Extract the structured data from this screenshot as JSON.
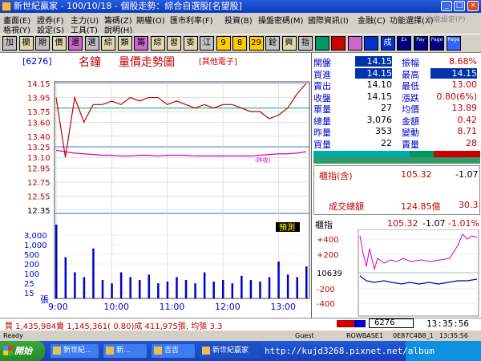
{
  "window": {
    "title": "新世紀贏家 - 100/10/18 - 個股走勢：綜合自選股[名望股]",
    "controls": [
      "_",
      "□",
      "×"
    ]
  },
  "menu": {
    "row1": [
      "畫面(E)",
      "證券(F)",
      "主力(U)",
      "籌碼(Z)",
      "期權(O)",
      "匯市利率(F)",
      "投資(B)",
      "操盤密碼(M)",
      "國際資訊(I)",
      "金融(C)",
      "功能選擇(X)",
      "功能設定(P)"
    ],
    "row2": [
      "格視(Y)",
      "設定(S)",
      "工具(T)",
      "說明(H)"
    ]
  },
  "toolbar": {
    "buttons": [
      "加",
      "欄",
      "期",
      "價",
      "還",
      "選",
      "綜",
      "類",
      "籌",
      "綜",
      "習",
      "委",
      "江",
      "9",
      "8",
      "29",
      "銓",
      "興",
      "指",
      "",
      "",
      "",
      "",
      "成",
      "Ex",
      "Pay",
      "Page",
      "Page"
    ]
  },
  "chart": {
    "stock_code": "[6276]",
    "name": "名鐘",
    "title": "量價走勢圖",
    "category": "[其他電子]",
    "ref_label": "(昨收)",
    "est_vol_label": "預測",
    "unit_label": "張",
    "price_ticks": [
      "14.15",
      "13.95",
      "13.75",
      "13.60",
      "13.40",
      "13.25",
      "13.10",
      "12.95",
      "12.75",
      "12.55",
      "12.35"
    ],
    "volume_ticks": [
      "3,000",
      "1,000",
      "500",
      "200",
      "100",
      "25",
      "15"
    ],
    "time_ticks": [
      "9:00",
      "10:00",
      "11:00",
      "12:00",
      "13:00"
    ],
    "colors": {
      "price": "#c00000",
      "avg": "#cc00cc",
      "volume": "#0000cc",
      "grid": "#00aa66"
    }
  },
  "chart_data": {
    "type": "line",
    "x": [
      "9:00",
      "9:10",
      "9:20",
      "9:30",
      "9:40",
      "9:50",
      "10:00",
      "10:10",
      "10:20",
      "10:30",
      "10:40",
      "10:50",
      "11:00",
      "11:10",
      "11:20",
      "11:30",
      "11:40",
      "11:50",
      "12:00",
      "12:10",
      "12:20",
      "12:30",
      "12:40",
      "12:50",
      "13:00",
      "13:10",
      "13:20",
      "13:30"
    ],
    "series": [
      {
        "values": [
          13.95,
          13.1,
          13.95,
          13.6,
          13.85,
          13.85,
          13.9,
          13.85,
          13.95,
          13.9,
          13.95,
          13.95,
          13.85,
          13.9,
          13.85,
          13.8,
          13.85,
          13.8,
          13.85,
          13.85,
          13.8,
          13.75,
          13.75,
          13.65,
          13.7,
          13.8,
          14.0,
          14.15
        ]
      },
      {
        "values": [
          13.2,
          13.18,
          13.16,
          13.15,
          13.14,
          13.13,
          13.13,
          13.12,
          13.12,
          13.13,
          13.13,
          13.12,
          13.13,
          13.13,
          13.13,
          13.12,
          13.12,
          13.12,
          13.12,
          13.12,
          13.12,
          13.12,
          13.13,
          13.14,
          13.15,
          13.15,
          13.16,
          13.18
        ]
      }
    ],
    "volume": [
      480,
      150,
      60,
      40,
      220,
      30,
      20,
      60,
      40,
      30,
      50,
      20,
      25,
      40,
      30,
      20,
      60,
      25,
      30,
      20,
      45,
      30,
      25,
      40,
      120,
      50,
      40,
      90
    ],
    "ylim": [
      12.35,
      14.15
    ],
    "reference_price": 13.25
  },
  "quote": {
    "rows": [
      {
        "l1": "開盤",
        "v1": "14.15",
        "l2": "振幅",
        "v2": "8.68%"
      },
      {
        "l1": "買進",
        "v1": "14.15",
        "l2": "最高",
        "v2": "14.15"
      },
      {
        "l1": "賣出",
        "v1": "14.10",
        "l2": "最低",
        "v2": "13.00"
      },
      {
        "l1": "收盤",
        "v1": "14.15",
        "l2": "漲跌",
        "v2": "0.80(6%)"
      },
      {
        "l1": "單量",
        "v1": "27",
        "l2": "均價",
        "v2": "13.89"
      },
      {
        "l1": "總量",
        "v1": "3,076",
        "l2": "金額",
        "v2": "0.42"
      },
      {
        "l1": "昨量",
        "v1": "353",
        "l2": "變動",
        "v2": "8.71"
      },
      {
        "l1": "買量",
        "v1": "22",
        "l2": "賣量",
        "v2": "28"
      }
    ]
  },
  "index_panel": {
    "label": "櫃指(含)",
    "value": "105.32",
    "change": "-1.07",
    "turnover_label": "成交總額",
    "turnover_value": "124.85億",
    "turnover_change": "30.3"
  },
  "mini_chart": {
    "label": "櫃指",
    "value": "105.32",
    "change": "-1.07",
    "pct": "-1.01%",
    "y_ticks": [
      "+400",
      "+200",
      "10639",
      "-200",
      "-400"
    ]
  },
  "status": {
    "summary": "買 1,435,984賣 1,145,361( 0.80)成 411,975張, 均張 3.3",
    "code_box": "6276",
    "time": "13:35:56"
  },
  "statusbar": {
    "left": "Ready",
    "mid1": "Guest",
    "mid2": "ROWBASE1",
    "mid3": "0E87C4B8_1",
    "time": "13:35:56"
  },
  "taskbar": {
    "start": "開始",
    "tasks": [
      "新世紀...",
      "新...",
      "吉吉",
      "新世紀贏家"
    ],
    "url": "http://kujd3268.pixnet.net/album"
  }
}
